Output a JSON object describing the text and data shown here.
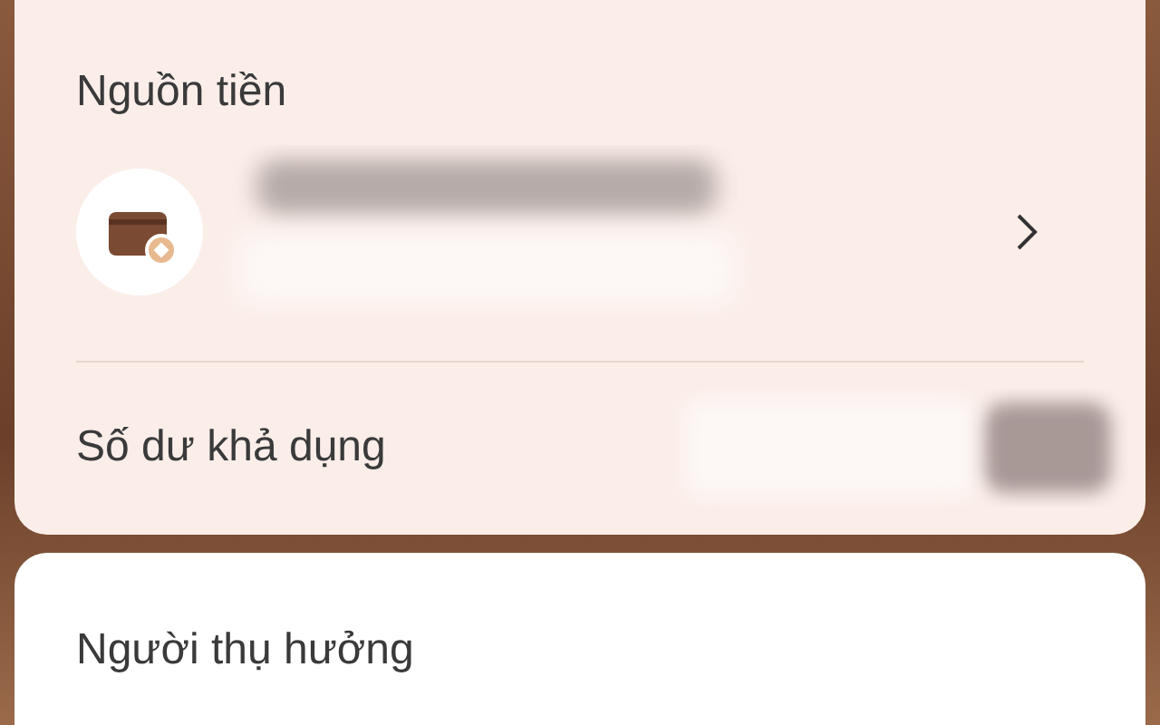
{
  "source_card": {
    "title": "Nguồn tiền",
    "balance_label": "Số dư khả dụng"
  },
  "beneficiary_card": {
    "title": "Người thụ hưởng"
  }
}
